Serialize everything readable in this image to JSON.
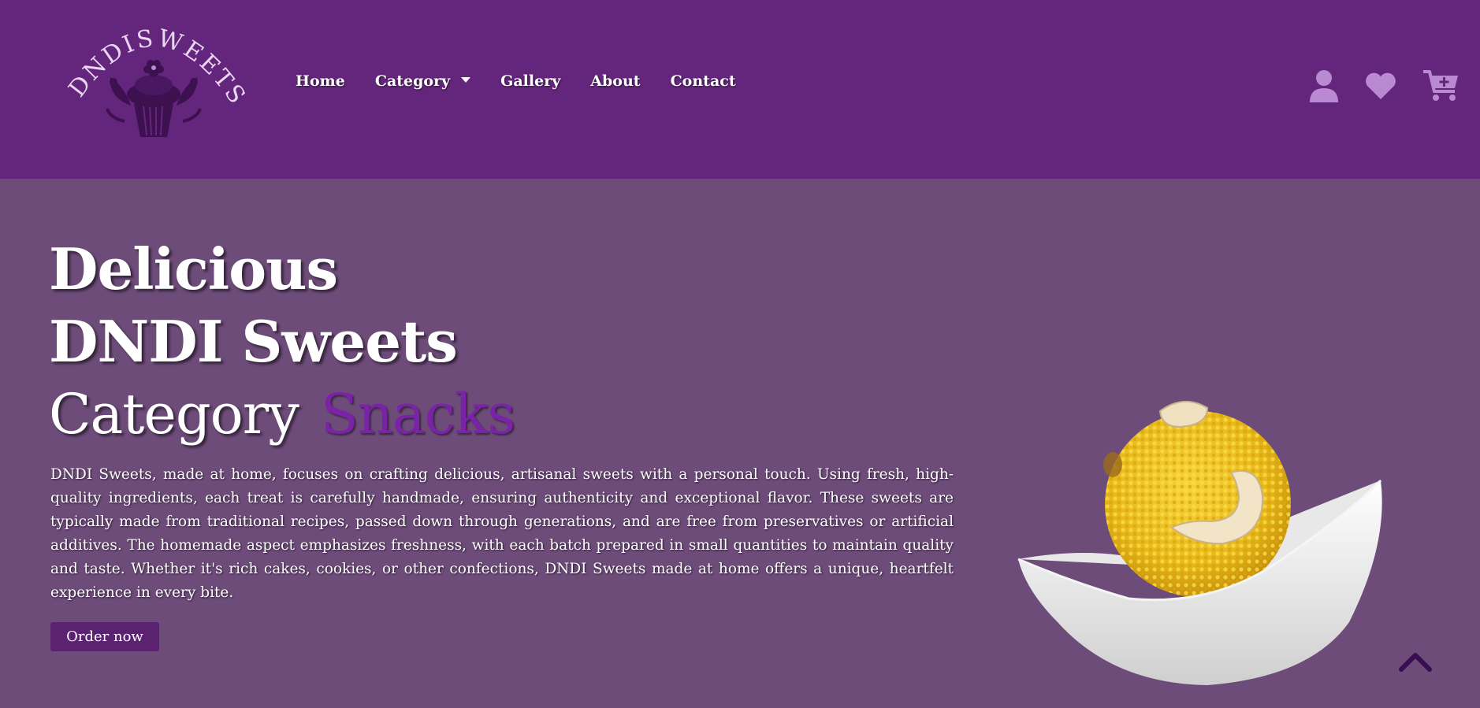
{
  "brand": {
    "name": "DNDISWEETS",
    "logo_icon": "cupcake-floral-icon"
  },
  "nav": {
    "items": [
      {
        "label": "Home"
      },
      {
        "label": "Category",
        "has_dropdown": true
      },
      {
        "label": "Gallery"
      },
      {
        "label": "About"
      },
      {
        "label": "Contact"
      }
    ]
  },
  "header_icons": [
    {
      "name": "user-icon"
    },
    {
      "name": "heart-icon"
    },
    {
      "name": "cart-plus-icon"
    }
  ],
  "hero": {
    "line1": "Delicious",
    "line2": "DNDI Sweets",
    "line3_prefix": "Category",
    "line3_accent": "Snacks",
    "description": "DNDI Sweets, made at home, focuses on crafting delicious, artisanal sweets with a personal touch. Using fresh, high-quality ingredients, each treat is carefully handmade, ensuring authenticity and exceptional flavor. These sweets are typically made from traditional recipes, passed down through generations, and are free from preservatives or artificial additives. The homemade aspect emphasizes freshness, with each batch prepared in small quantities to maintain quality and taste. Whether it's rich cakes, cookies, or other confections, DNDI Sweets made at home offers a unique, heartfelt experience in every bite.",
    "order_button": "Order now"
  },
  "colors": {
    "header_bg": "#64267c",
    "hero_bg": "#6e4c7a",
    "accent": "#7a22a8",
    "icon": "#b98ad1",
    "button_bg": "#5b2272"
  }
}
